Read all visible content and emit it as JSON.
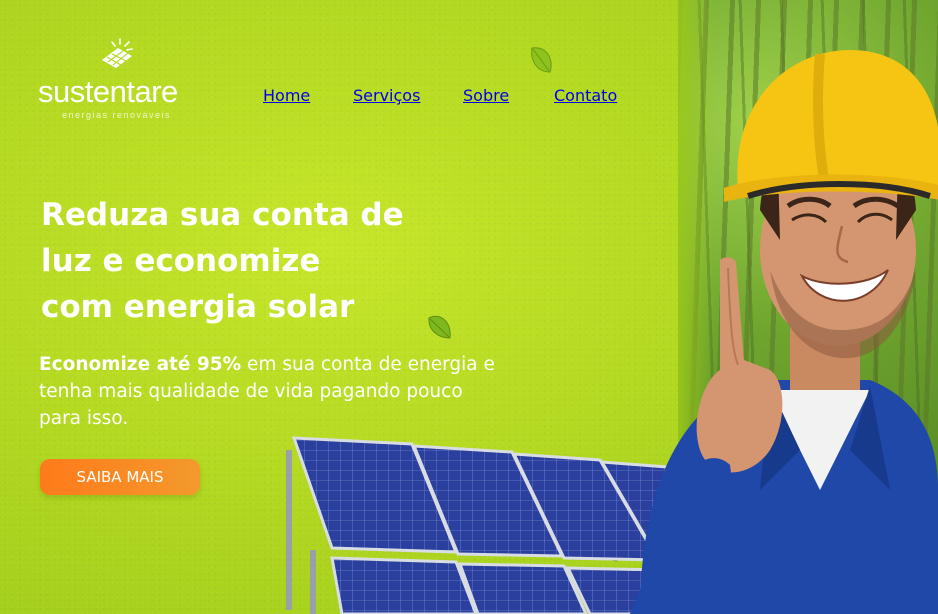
{
  "brand": {
    "name": "sustentare",
    "tagline": "energias renováveis",
    "logo_icon": "solar-panel-sun-icon"
  },
  "nav": {
    "items": [
      {
        "label": "Home"
      },
      {
        "label": "Serviços"
      },
      {
        "label": "Sobre"
      },
      {
        "label": "Contato"
      }
    ]
  },
  "hero": {
    "headline_lines": [
      "Reduza sua conta de",
      "luz e economize",
      "com energia solar"
    ],
    "lead_bold": "Economize até 95%",
    "lead_rest": " em sua conta de energia e tenha mais qualidade de vida pagando pouco para isso.",
    "cta_label": "SAIBA MAIS"
  },
  "colors": {
    "background": "#b3d921",
    "cta_start": "#ff7a1a",
    "cta_end": "#f39a2c",
    "text": "#ffffff",
    "panel_blue": "#2a3d9a",
    "helmet": "#f6c413",
    "uniform": "#1f48a8"
  },
  "images": {
    "hero_photo": "smiling-worker-yellow-helmet-photo",
    "panels": "solar-panels-photo",
    "background": "forest-photo"
  }
}
